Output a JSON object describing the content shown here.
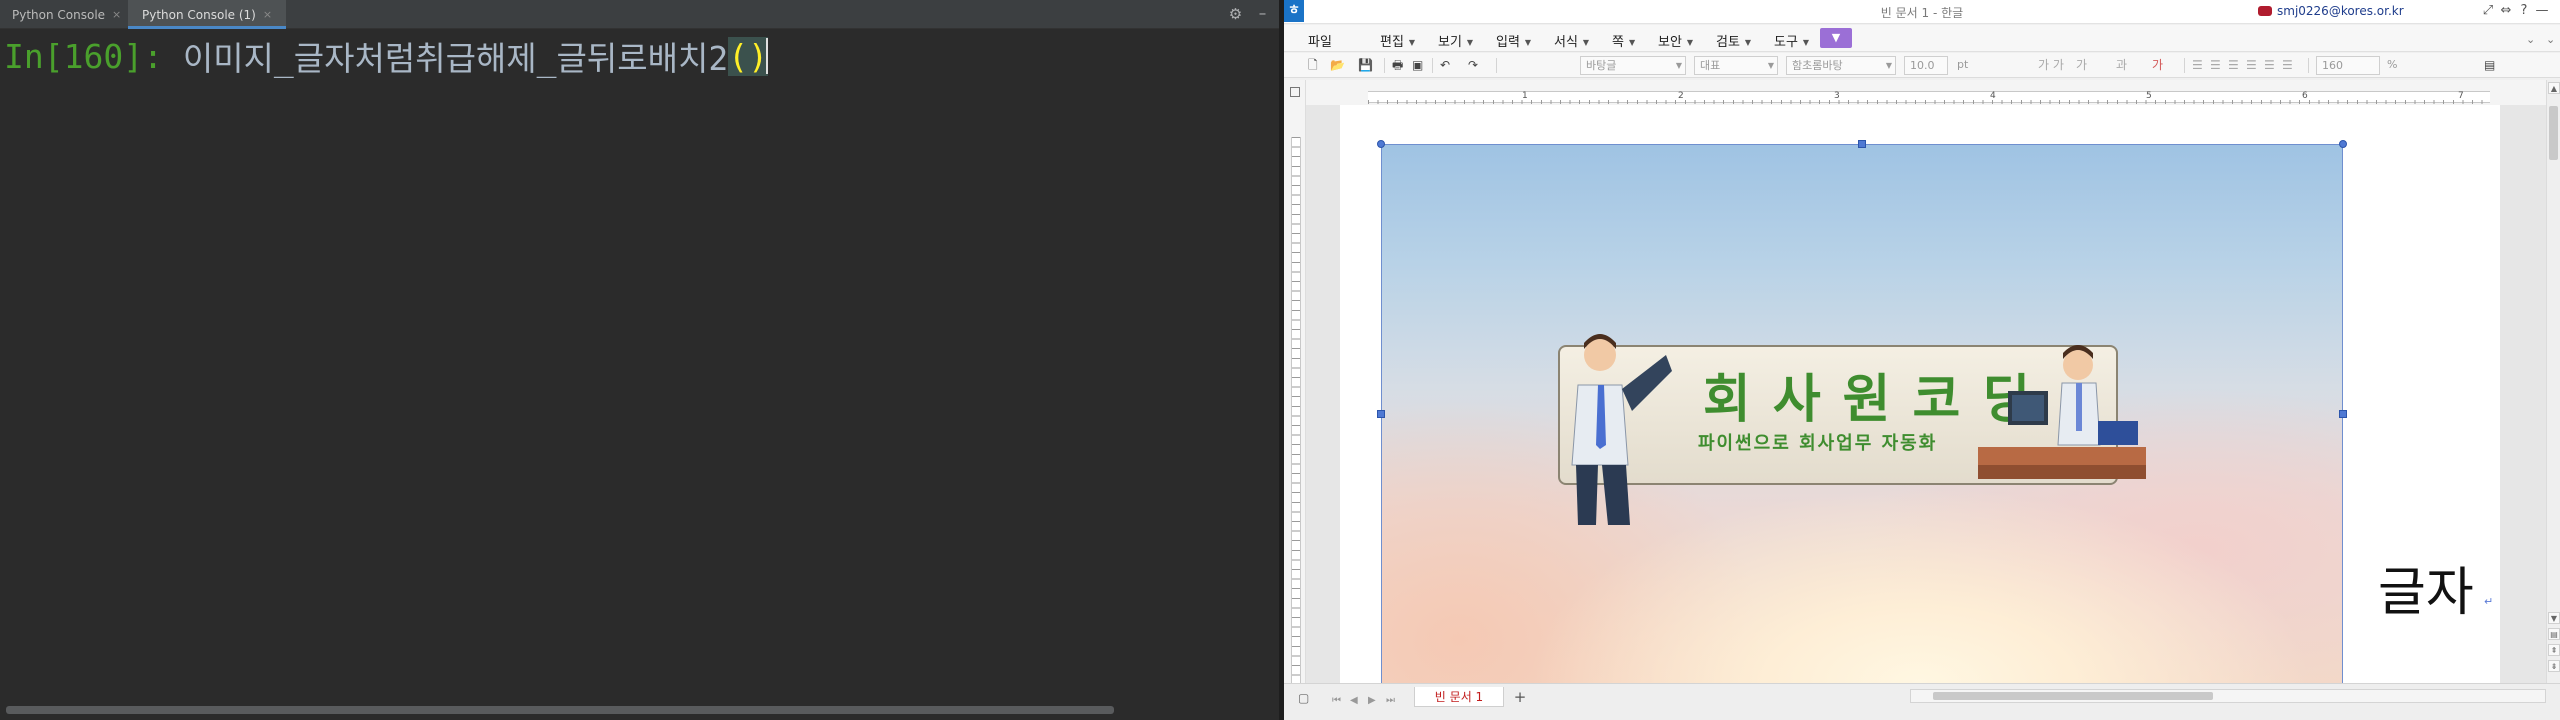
{
  "console": {
    "tabs": [
      {
        "label": "Python Console",
        "close": "×"
      },
      {
        "label": "Python Console (1)",
        "close": "×"
      }
    ],
    "prompt": "In[160]:",
    "command": "이미지_글자처럼취급해제_글뒤로배치2",
    "parens": "()"
  },
  "hwp": {
    "title": "빈 문서 1 - 한글",
    "account": "smj0226@kores.or.kr",
    "window_buttons": [
      "—",
      "□",
      "✕"
    ],
    "menu": [
      {
        "label": "파일",
        "dropdown": false
      },
      {
        "label": "편집",
        "dropdown": true
      },
      {
        "label": "보기",
        "dropdown": true
      },
      {
        "label": "입력",
        "dropdown": true
      },
      {
        "label": "서식",
        "dropdown": true
      },
      {
        "label": "쪽",
        "dropdown": true
      },
      {
        "label": "보안",
        "dropdown": true
      },
      {
        "label": "검토",
        "dropdown": true
      },
      {
        "label": "도구",
        "dropdown": true
      }
    ],
    "toolbar": {
      "style": "바탕글",
      "lang": "대표",
      "font": "함초롬바탕",
      "size": "10.0",
      "unit": "pt",
      "zoom": "160",
      "zoom_unit": "%"
    },
    "ruler_numbers": [
      "1",
      "2",
      "3",
      "4",
      "5",
      "6",
      "7"
    ],
    "banner_title": "회사원코딩",
    "banner_subtitle": "파이썬으로 회사업무 자동화",
    "document_text": "글자",
    "return_mark": "↵",
    "sheet_tab": "빈 문서 1",
    "colors": {
      "console_bg": "#2b2b2b",
      "prompt": "#4aa02c",
      "accent_tab": "#4a88c7",
      "banner_green": "#3f8d2f",
      "selection_handle": "#4f79d3",
      "sheet_tab_text": "#c21c1c"
    }
  }
}
